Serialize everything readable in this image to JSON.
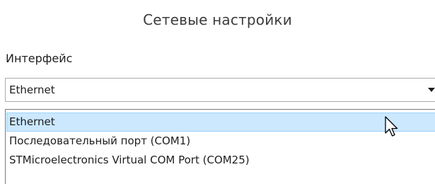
{
  "dialog": {
    "title": "Сетевые настройки"
  },
  "interface": {
    "label": "Интерфейс",
    "selected": "Ethernet",
    "options": [
      {
        "label": "Ethernet",
        "selected": true
      },
      {
        "label": "Последовательный порт (COM1)",
        "selected": false
      },
      {
        "label": "STMicroelectronics Virtual COM Port (COM25)",
        "selected": false
      }
    ]
  },
  "colors": {
    "highlight_fill": "#cce8ff",
    "highlight_border": "#99d1ff",
    "combo_border": "#acacac"
  },
  "icons": {
    "dropdown_arrow": "chevron-down-icon",
    "pointer": "mouse-pointer-icon"
  }
}
